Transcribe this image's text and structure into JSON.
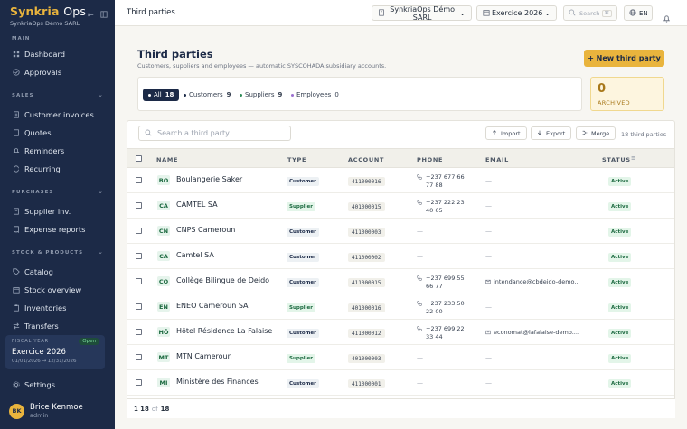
{
  "sidebar": {
    "logo_main": "Synkria",
    "logo_ops": "Ops",
    "company": "SynkriaOps Démo SARL",
    "sections": {
      "main": "MAIN",
      "sales": "SALES",
      "purchases": "PURCHASES",
      "stock": "STOCK & PRODUCTS"
    },
    "items": {
      "dashboard": "Dashboard",
      "approvals": "Approvals",
      "customer_invoices": "Customer invoices",
      "quotes": "Quotes",
      "reminders": "Reminders",
      "recurring": "Recurring",
      "supplier_inv": "Supplier inv.",
      "expense_reports": "Expense reports",
      "catalog": "Catalog",
      "stock_overview": "Stock overview",
      "inventories": "Inventories",
      "transfers": "Transfers",
      "settings": "Settings"
    },
    "fiscal": {
      "label": "FISCAL YEAR",
      "status": "Open",
      "year": "Exercice 2026",
      "range": "01/01/2026 → 12/31/2026"
    },
    "user": {
      "initials": "BK",
      "name": "Brice Kenmoe",
      "role": "admin"
    }
  },
  "topbar": {
    "title": "Third parties",
    "company_line1": "SynkriaOps Démo",
    "company_line2": "SARL",
    "fiscal_year": "Exercice 2026",
    "search_label": "Search",
    "search_shortcut": "⌘",
    "language": "EN"
  },
  "page": {
    "title": "Third parties",
    "description": "Customers, suppliers and employees — automatic SYSCOHADA subsidiary accounts.",
    "new_button": "+ New third party",
    "archived_count": "0",
    "archived_label": "ARCHIVED"
  },
  "filters": {
    "all": {
      "label": "All",
      "count": "18"
    },
    "customers": {
      "label": "Customers",
      "count": "9"
    },
    "suppliers": {
      "label": "Suppliers",
      "count": "9"
    },
    "employees": {
      "label": "Employees",
      "count": "0"
    }
  },
  "toolbar": {
    "search_placeholder": "Search a third party...",
    "import": "Import",
    "export": "Export",
    "merge": "Merge",
    "count_text": "18 third parties"
  },
  "table": {
    "headers": {
      "name": "NAME",
      "type": "TYPE",
      "account": "ACCOUNT",
      "phone": "PHONE",
      "email": "EMAIL",
      "status": "STATUS"
    },
    "rows": [
      {
        "initials": "BO",
        "name": "Boulangerie Saker",
        "type": "Customer",
        "account": "411000016",
        "phone1": "+237 677 66",
        "phone2": "77 88",
        "email": "—",
        "status": "Active"
      },
      {
        "initials": "CA",
        "name": "CAMTEL SA",
        "type": "Supplier",
        "account": "401000015",
        "phone1": "+237 222 23",
        "phone2": "40 65",
        "email": "—",
        "status": "Active"
      },
      {
        "initials": "CN",
        "name": "CNPS Cameroun",
        "type": "Customer",
        "account": "411000003",
        "phone1": "—",
        "phone2": "",
        "email": "—",
        "status": "Active"
      },
      {
        "initials": "CA",
        "name": "Camtel SA",
        "type": "Customer",
        "account": "411000002",
        "phone1": "—",
        "phone2": "",
        "email": "—",
        "status": "Active"
      },
      {
        "initials": "CO",
        "name": "Collège Bilingue de Deido",
        "type": "Customer",
        "account": "411000015",
        "phone1": "+237 699 55",
        "phone2": "66 77",
        "email": "intendance@cbdeido-demo...",
        "status": "Active"
      },
      {
        "initials": "EN",
        "name": "ENEO Cameroun SA",
        "type": "Supplier",
        "account": "401000016",
        "phone1": "+237 233 50",
        "phone2": "22 00",
        "email": "—",
        "status": "Active"
      },
      {
        "initials": "HÔ",
        "name": "Hôtel Résidence La Falaise",
        "type": "Customer",
        "account": "411000012",
        "phone1": "+237 699 22",
        "phone2": "33 44",
        "email": "economat@lafalaise-demo....",
        "status": "Active"
      },
      {
        "initials": "MT",
        "name": "MTN Cameroun",
        "type": "Supplier",
        "account": "401000003",
        "phone1": "—",
        "phone2": "",
        "email": "—",
        "status": "Active"
      },
      {
        "initials": "MI",
        "name": "Ministère des Finances",
        "type": "Customer",
        "account": "411000001",
        "phone1": "—",
        "phone2": "",
        "email": "—",
        "status": "Active"
      }
    ]
  },
  "pager": {
    "from": "1",
    "to": "18",
    "of": "of",
    "total": "18"
  }
}
